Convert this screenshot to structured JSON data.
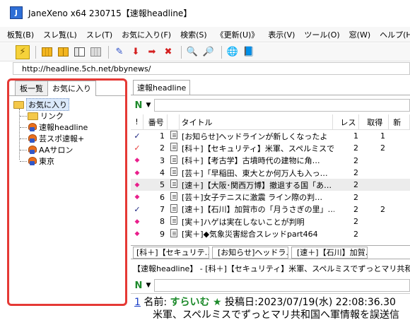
{
  "window": {
    "title": "JaneXeno x64 230715【速報headline】"
  },
  "menu": [
    "板覧(B)",
    "スレ覧(L)",
    "スレ(T)",
    "お気に入り(F)",
    "検索(S)",
    "《更新(U)》",
    "表示(V)",
    "ツール(O)",
    "窓(W)",
    "ヘルプ(H)"
  ],
  "address": {
    "url": "http://headline.5ch.net/bbynews/"
  },
  "left_tabs": [
    "板一覧",
    "お気に入り"
  ],
  "favorites_tree": {
    "root": "お気に入り",
    "items": [
      "リンク",
      "速報headline",
      "芸スポ速報+",
      "AAサロン",
      "東京"
    ]
  },
  "board_tab": "速報headline",
  "thread_list": {
    "headers": {
      "mark": "!",
      "num": "番号",
      "title": "タイトル",
      "res": "レス",
      "get": "取得",
      "new": "新"
    },
    "rows": [
      {
        "mark": "✓",
        "num": "1",
        "title": "[お知らせ]ヘッドラインが新しくなったよ",
        "res": "1",
        "get": "1"
      },
      {
        "mark": "✓",
        "num": "2",
        "title": "[科＋]【セキュリティ】米軍、スペルミスでずっ…",
        "res": "2",
        "get": "2"
      },
      {
        "mark": "◆",
        "num": "3",
        "title": "[科＋]【考古学】古墳時代の建物に角…",
        "res": "2",
        "get": ""
      },
      {
        "mark": "◆",
        "num": "4",
        "title": "[芸＋]「早稲田、東大とか何万人も入っ…",
        "res": "2",
        "get": ""
      },
      {
        "mark": "◆",
        "num": "5",
        "title": "[速＋]【大阪･関西万博】撤退する国「あ…",
        "res": "2",
        "get": ""
      },
      {
        "mark": "◆",
        "num": "6",
        "title": "[芸＋]女子テニスに激震 ライン際の判…",
        "res": "2",
        "get": ""
      },
      {
        "mark": "✓",
        "num": "7",
        "title": "[速＋]【石川】加賀市の「月うさぎの里」…",
        "res": "2",
        "get": "2"
      },
      {
        "mark": "◆",
        "num": "8",
        "title": "[実＋]ハゲは実在しないことが判明",
        "res": "2",
        "get": ""
      },
      {
        "mark": "◆",
        "num": "9",
        "title": "[実＋]◆気象災害総合スレッドpart464",
        "res": "2",
        "get": ""
      }
    ]
  },
  "thread_tabs": [
    "[科＋]【セキュリテ…",
    "[お知らせ]ヘッドラ…",
    "[速＋]【石川】加賀…"
  ],
  "thread_view": {
    "title": "【速報headline】 - [科＋]【セキュリティ】米軍、スペルミスでずっとマリ共和",
    "post": {
      "num": "1",
      "name_label": "名前:",
      "name": "すらいむ",
      "star": "★",
      "date_label": "投稿日:",
      "date": "2023/07/19(水) 22:08:36.30",
      "body": "米軍、スペルミスでずっとマリ共和国へ軍情報を誤送信"
    }
  },
  "colors": {
    "highlight_border": "#e53935",
    "name_green": "#1d8a2b",
    "link_blue": "#1a3fc7",
    "unread_diamond": "#e91e8c"
  }
}
